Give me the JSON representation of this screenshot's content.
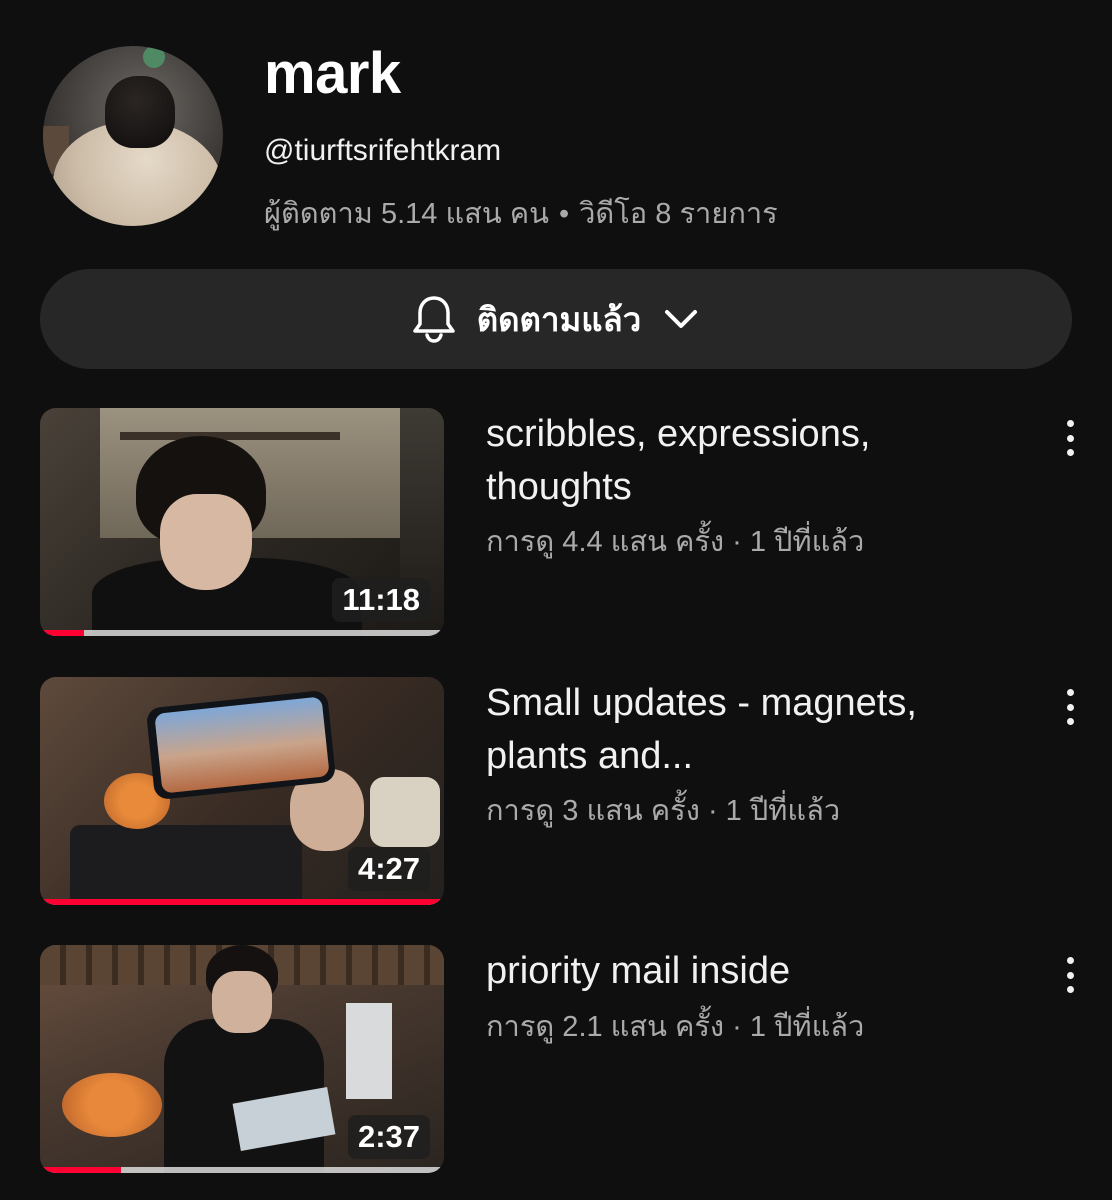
{
  "channel": {
    "name": "mark",
    "handle": "@tiurftsrifehtkram",
    "subscribers": "ผู้ติดตาม 5.14 แสน คน",
    "separator": "•",
    "video_count": "วิดีโอ 8 รายการ"
  },
  "subscribe_button": {
    "label": "ติดตามแล้ว",
    "icon": "bell-icon",
    "dropdown_icon": "chevron-down-icon"
  },
  "colors": {
    "background": "#0f0f0f",
    "button_bg": "#272727",
    "progress": "#ff0033",
    "secondary_text": "#aaaaaa"
  },
  "videos": [
    {
      "title": "scribbles, expressions, thoughts",
      "meta": "การดู 4.4 แสน ครั้ง · 1 ปีที่แล้ว",
      "duration": "11:18",
      "watched_fraction": 0.11
    },
    {
      "title": "Small updates - magnets, plants and...",
      "meta": "การดู 3 แสน ครั้ง · 1 ปีที่แล้ว",
      "duration": "4:27",
      "watched_fraction": 1.0
    },
    {
      "title": "priority mail inside",
      "meta": "การดู 2.1 แสน ครั้ง · 1 ปีที่แล้ว",
      "duration": "2:37",
      "watched_fraction": 0.2
    }
  ]
}
